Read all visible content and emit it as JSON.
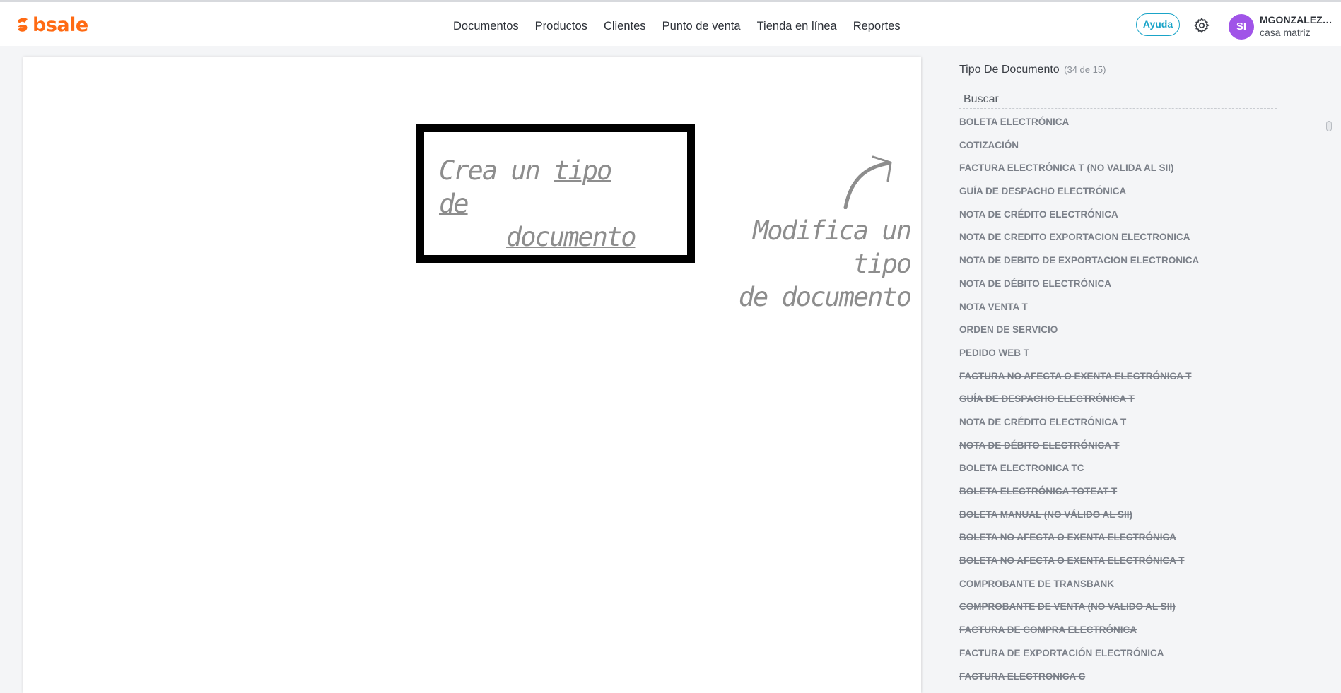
{
  "app": {
    "logo_text": "bsale",
    "brand_color": "#ff6a13"
  },
  "nav": {
    "items": [
      "Documentos",
      "Productos",
      "Clientes",
      "Punto de venta",
      "Tienda en línea",
      "Reportes"
    ]
  },
  "header": {
    "help_label": "Ayuda",
    "settings_icon": "gear-icon",
    "avatar_initials": "SI",
    "avatar_color": "#a054e8",
    "user_name": "MGONZALEZ_...",
    "user_branch": "casa matriz"
  },
  "main": {
    "create_prefix": "Crea un ",
    "create_link_1": "tipo de",
    "create_link_2": "documento",
    "modify_line_1": "Modifica un tipo",
    "modify_line_2": "de documento"
  },
  "sidebar": {
    "title": "Tipo De Documento",
    "count": "(34 de 15)",
    "search_placeholder": "Buscar",
    "documents": [
      {
        "label": "BOLETA ELECTRÓNICA",
        "disabled": false
      },
      {
        "label": "COTIZACIÓN",
        "disabled": false
      },
      {
        "label": "FACTURA ELECTRÓNICA T (NO VALIDA AL SII)",
        "disabled": false
      },
      {
        "label": "GUÍA DE DESPACHO ELECTRÓNICA",
        "disabled": false
      },
      {
        "label": "NOTA DE CRÉDITO ELECTRÓNICA",
        "disabled": false
      },
      {
        "label": "NOTA DE CREDITO EXPORTACION ELECTRONICA",
        "disabled": false
      },
      {
        "label": "NOTA DE DEBITO DE EXPORTACION ELECTRONICA",
        "disabled": false
      },
      {
        "label": "NOTA DE DÉBITO ELECTRÓNICA",
        "disabled": false
      },
      {
        "label": "NOTA VENTA T",
        "disabled": false
      },
      {
        "label": "ORDEN DE SERVICIO",
        "disabled": false
      },
      {
        "label": "PEDIDO WEB T",
        "disabled": false
      },
      {
        "label": "FACTURA NO AFECTA O EXENTA ELECTRÓNICA T",
        "disabled": true
      },
      {
        "label": "GUÍA DE DESPACHO ELECTRÓNICA T",
        "disabled": true
      },
      {
        "label": "NOTA DE CRÉDITO ELECTRÓNICA T",
        "disabled": true
      },
      {
        "label": "NOTA DE DÉBITO ELECTRÓNICA T",
        "disabled": true
      },
      {
        "label": "BOLETA ELECTRONICA TC",
        "disabled": true
      },
      {
        "label": "BOLETA ELECTRÓNICA TOTEAT T",
        "disabled": true
      },
      {
        "label": "BOLETA MANUAL (NO VÁLIDO AL SII)",
        "disabled": true
      },
      {
        "label": "BOLETA NO AFECTA O EXENTA ELECTRÓNICA",
        "disabled": true
      },
      {
        "label": "BOLETA NO AFECTA O EXENTA ELECTRÓNICA T",
        "disabled": true
      },
      {
        "label": "COMPROBANTE DE TRANSBANK",
        "disabled": true
      },
      {
        "label": "COMPROBANTE DE VENTA (NO VALIDO AL SII)",
        "disabled": true
      },
      {
        "label": "FACTURA DE COMPRA ELECTRÓNICA",
        "disabled": true
      },
      {
        "label": "FACTURA DE EXPORTACIÓN ELECTRÓNICA",
        "disabled": true
      },
      {
        "label": "FACTURA ELECTRONICA C",
        "disabled": true
      }
    ]
  }
}
